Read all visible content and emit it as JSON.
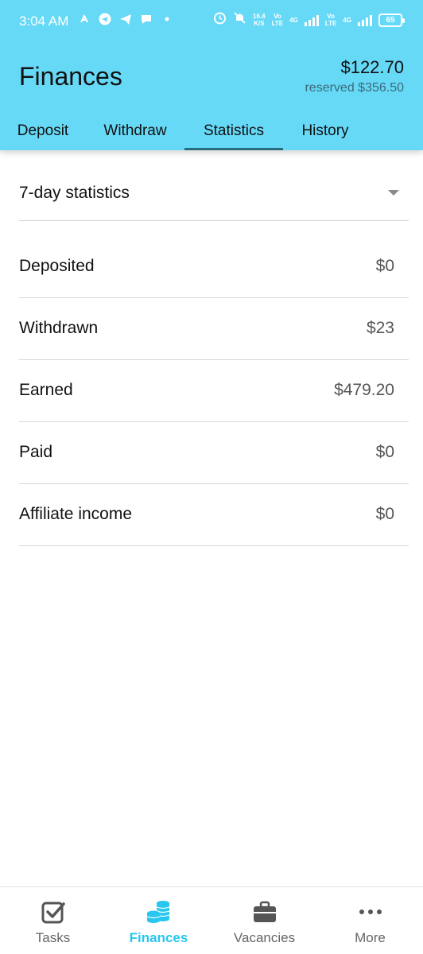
{
  "status_bar": {
    "time": "3:04 AM",
    "speed_value": "16.4",
    "speed_unit": "K/S",
    "net1_top": "Vo",
    "net1_bottom": "LTE",
    "net2_top": "Vo",
    "net2_bottom": "LTE",
    "gen1": "4G",
    "gen2": "4G",
    "battery": "65"
  },
  "header": {
    "title": "Finances",
    "balance": "$122.70",
    "reserved": "reserved $356.50"
  },
  "tabs": [
    {
      "label": "Deposit"
    },
    {
      "label": "Withdraw"
    },
    {
      "label": "Statistics"
    },
    {
      "label": "History"
    }
  ],
  "period_select": {
    "selected": "7-day statistics"
  },
  "stats": [
    {
      "label": "Deposited",
      "value": "$0"
    },
    {
      "label": "Withdrawn",
      "value": "$23"
    },
    {
      "label": "Earned",
      "value": "$479.20"
    },
    {
      "label": "Paid",
      "value": "$0"
    },
    {
      "label": "Affiliate income",
      "value": "$0"
    }
  ],
  "bottom_nav": [
    {
      "label": "Tasks",
      "icon": "checkbox-icon"
    },
    {
      "label": "Finances",
      "icon": "coins-icon"
    },
    {
      "label": "Vacancies",
      "icon": "briefcase-icon"
    },
    {
      "label": "More",
      "icon": "more-dots-icon"
    }
  ],
  "colors": {
    "header_bg": "#66d9f7",
    "accent": "#29c6ef",
    "tab_indicator": "#2a6d80"
  }
}
